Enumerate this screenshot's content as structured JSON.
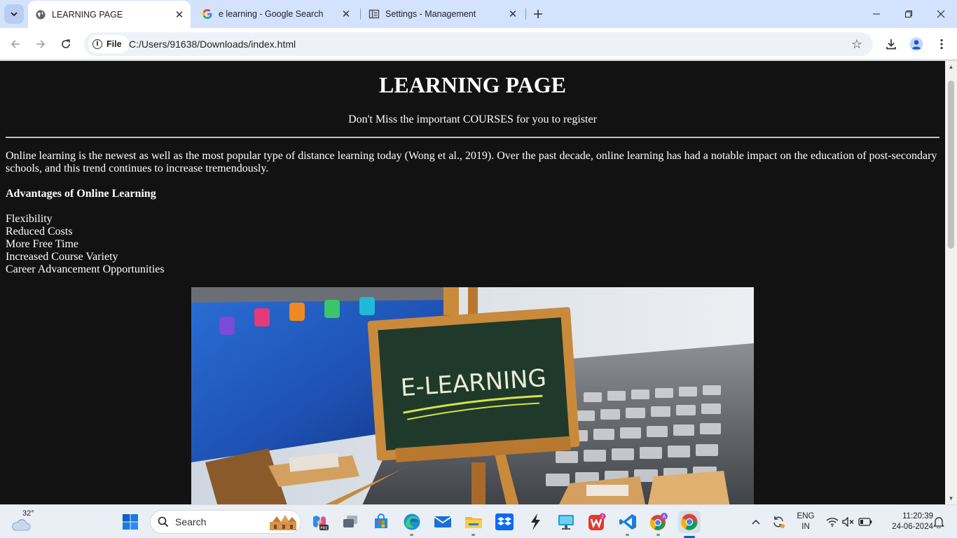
{
  "browser": {
    "tabs": [
      {
        "title": "LEARNING PAGE",
        "active": true,
        "favicon": "globe-icon"
      },
      {
        "title": "e learning - Google Search",
        "active": false,
        "favicon": "google-icon"
      },
      {
        "title": "Settings - Management",
        "active": false,
        "favicon": "settings-icon"
      }
    ],
    "address": {
      "chip_label": "File",
      "url": "C:/Users/91638/Downloads/index.html"
    }
  },
  "page": {
    "heading": "LEARNING PAGE",
    "subheading": "Don't Miss the important COURSES for you to register",
    "intro": "Online learning is the newest as well as the most popular type of distance learning today (Wong et al., 2019). Over the past decade, online learning has had a notable impact on the education of post-secondary schools, and this trend continues to increase tremendously.",
    "advantages_title": "Advantages of Online Learning",
    "advantages": [
      "Flexibility",
      "Reduced Costs",
      "More Free Time",
      "Increased Course Variety",
      "Career Advancement Opportunities"
    ],
    "image_text": "E-LEARNING"
  },
  "taskbar": {
    "weather_temp": "32°",
    "search_placeholder": "Search",
    "language_line1": "ENG",
    "language_line2": "IN",
    "time": "11:20:39",
    "date": "24-06-2024",
    "colors": {
      "active_indicator": "#0a63c9",
      "page_background": "#121212"
    }
  }
}
